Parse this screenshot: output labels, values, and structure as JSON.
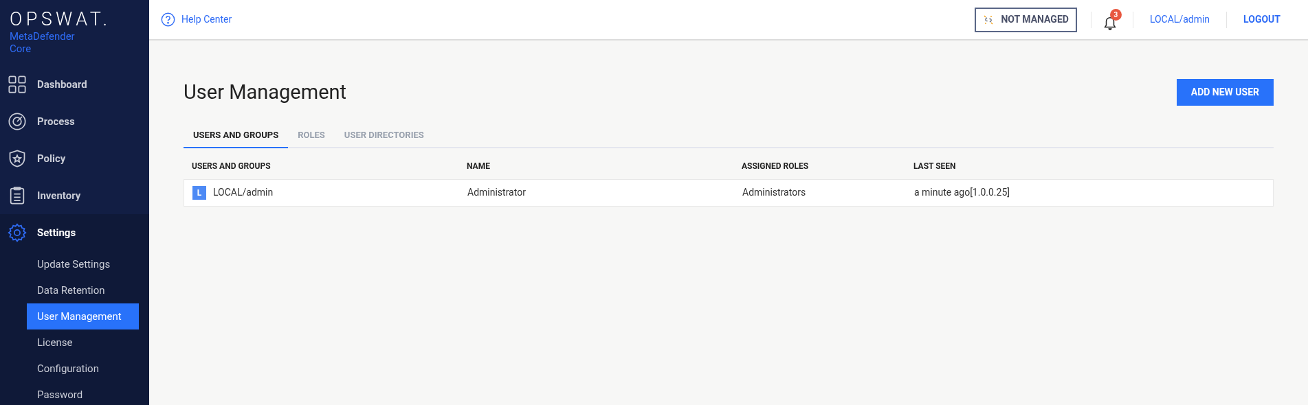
{
  "sidebar": {
    "logo": "OPSWAT.",
    "product": [
      "MetaDefender",
      "Core"
    ],
    "items": [
      {
        "label": "Dashboard",
        "expanded": false
      },
      {
        "label": "Process",
        "expanded": false
      },
      {
        "label": "Policy",
        "expanded": false
      },
      {
        "label": "Inventory",
        "expanded": false
      },
      {
        "label": "Settings",
        "expanded": true,
        "children": [
          {
            "label": "Update Settings",
            "selected": false
          },
          {
            "label": "Data Retention",
            "selected": false
          },
          {
            "label": "User Management",
            "selected": true
          },
          {
            "label": "License",
            "selected": false
          },
          {
            "label": "Configuration",
            "selected": false
          },
          {
            "label": "Password",
            "selected": false
          }
        ]
      }
    ]
  },
  "header": {
    "help": "Help Center",
    "status": "NOT MANAGED",
    "notifications": "3",
    "user": "LOCAL/admin",
    "logout": "LOGOUT"
  },
  "page": {
    "title": "User Management",
    "add_button": "ADD NEW USER",
    "tabs": [
      {
        "label": "USERS AND GROUPS",
        "selected": true
      },
      {
        "label": "ROLES",
        "selected": false
      },
      {
        "label": "USER DIRECTORIES",
        "selected": false
      }
    ],
    "table": {
      "columns": [
        "USERS AND GROUPS",
        "NAME",
        "ASSIGNED ROLES",
        "LAST SEEN"
      ],
      "rows": [
        {
          "badge": "L",
          "user": "LOCAL/admin",
          "name": "Administrator",
          "roles": "Administrators",
          "last_seen": "a minute ago[1.0.0.25]"
        }
      ]
    }
  }
}
